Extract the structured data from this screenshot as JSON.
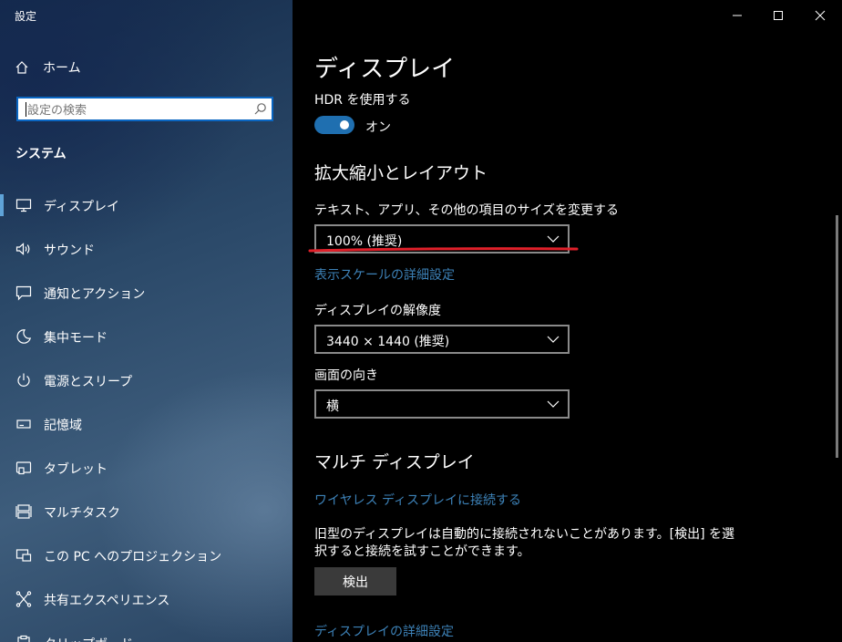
{
  "window": {
    "title": "設定",
    "controls": [
      "minimize-icon",
      "maximize-icon",
      "close-icon"
    ]
  },
  "sidebar": {
    "home_label": "ホーム",
    "search_placeholder": "設定の検索",
    "section_title": "システム",
    "items": [
      {
        "label": "ディスプレイ",
        "icon": "monitor-icon",
        "selected": true
      },
      {
        "label": "サウンド",
        "icon": "speaker-icon"
      },
      {
        "label": "通知とアクション",
        "icon": "notification-icon"
      },
      {
        "label": "集中モード",
        "icon": "moon-icon"
      },
      {
        "label": "電源とスリープ",
        "icon": "power-icon"
      },
      {
        "label": "記憶域",
        "icon": "storage-icon"
      },
      {
        "label": "タブレット",
        "icon": "tablet-icon"
      },
      {
        "label": "マルチタスク",
        "icon": "multitask-icon"
      },
      {
        "label": "この PC へのプロジェクション",
        "icon": "projection-icon"
      },
      {
        "label": "共有エクスペリエンス",
        "icon": "share-icon"
      },
      {
        "label": "クリップボード",
        "icon": "clipboard-icon"
      }
    ]
  },
  "main": {
    "page_title": "ディスプレイ",
    "hdr": {
      "label": "HDR を使用する",
      "toggle_state": "オン",
      "on": true
    },
    "scale_layout": {
      "heading": "拡大縮小とレイアウト",
      "size_label": "テキスト、アプリ、その他の項目のサイズを変更する",
      "size_value": "100% (推奨)",
      "advanced_link": "表示スケールの詳細設定",
      "resolution_label": "ディスプレイの解像度",
      "resolution_value": "3440 × 1440 (推奨)",
      "orientation_label": "画面の向き",
      "orientation_value": "横"
    },
    "multi_display": {
      "heading": "マルチ ディスプレイ",
      "wireless_link": "ワイヤレス ディスプレイに接続する",
      "description": "旧型のディスプレイは自動的に接続されないことがあります。[検出] を選択すると接続を試すことができます。",
      "detect_button": "検出",
      "detail_link": "ディスプレイの詳細設定"
    }
  },
  "colors": {
    "accent": "#1f6fb0",
    "link": "#3d82b8",
    "annotation": "#e0202a"
  }
}
